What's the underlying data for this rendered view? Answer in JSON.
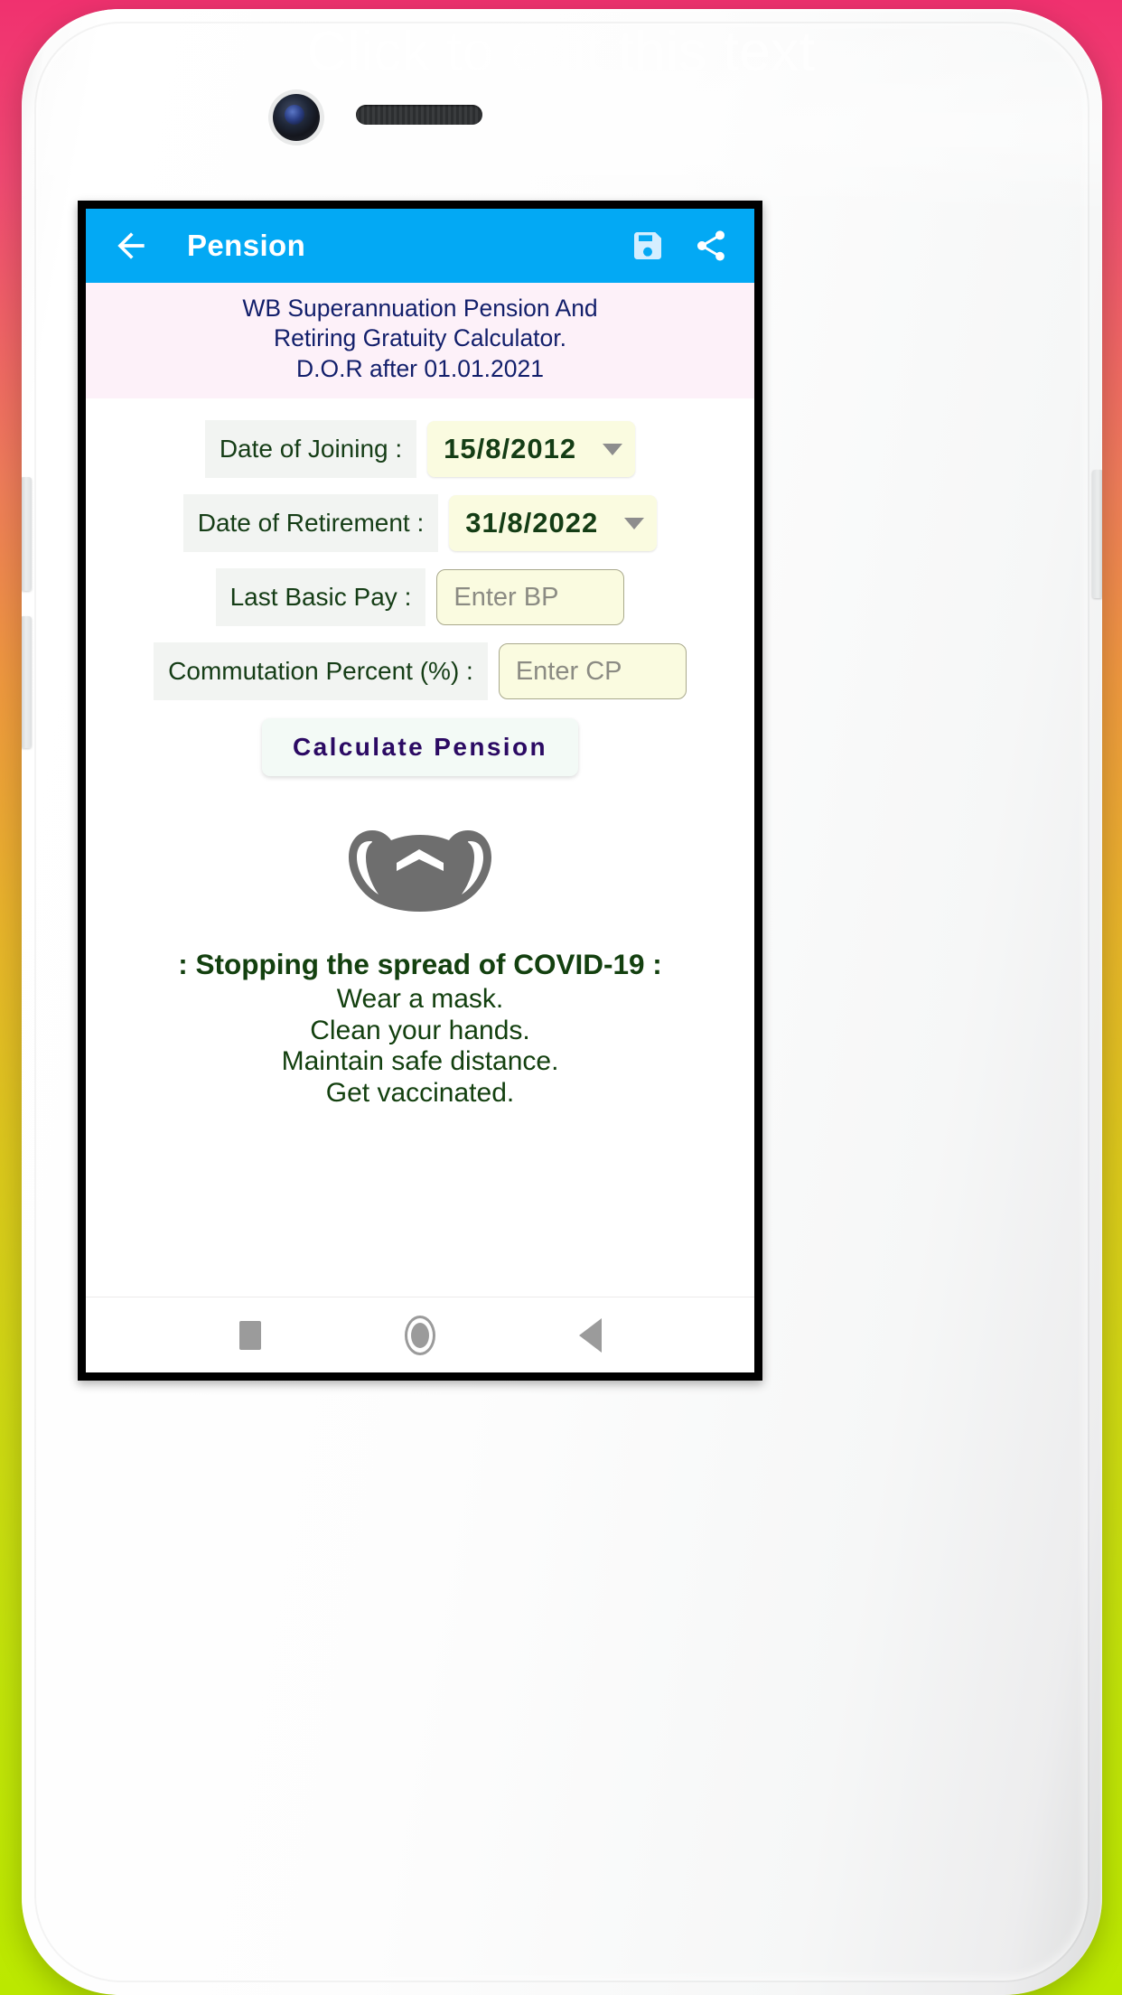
{
  "overlay": {
    "hint": "Click to edit this text"
  },
  "device": {
    "camera_icon": "camera-lens-icon",
    "speaker_icon": "earpiece-speaker-icon",
    "volume_up_button": "volume-up-button",
    "volume_down_button": "volume-down-button",
    "power_button": "power-button"
  },
  "appbar": {
    "back_icon": "back-arrow-icon",
    "title": "Pension",
    "save_icon": "save-floppy-icon",
    "share_icon": "share-icon",
    "background": "#03A9F4",
    "title_color": "#FFFFFF"
  },
  "banner": {
    "line1": "WB Superannuation Pension And",
    "line2": "Retiring Gratuity Calculator.",
    "line3": "D.O.R after 01.01.2021",
    "background": "#FDF1F9",
    "text_color": "#121F6B"
  },
  "form": {
    "rows": [
      {
        "label": "Date of Joining :",
        "type": "dropdown",
        "value": "15/8/2012",
        "caret_icon": "chevron-down-icon"
      },
      {
        "label": "Date of Retirement :",
        "type": "dropdown",
        "value": "31/8/2022",
        "caret_icon": "chevron-down-icon"
      },
      {
        "label": "Last Basic Pay :",
        "type": "input",
        "value": "",
        "placeholder": "Enter BP"
      },
      {
        "label": "Commutation Percent (%) :",
        "type": "input",
        "value": "",
        "placeholder": "Enter CP"
      }
    ],
    "label_background": "#F2F4F2",
    "label_color": "#153D16",
    "field_background": "#FAFBE0",
    "field_border": "#A9A98C"
  },
  "calculate": {
    "label": "Calculate Pension",
    "text_color": "#2B0A63",
    "background": "#F3FAF6"
  },
  "covid": {
    "mask_icon": "face-mask-icon",
    "mask_color": "#6E6E6E",
    "heading": ": Stopping the spread of COVID-19 :",
    "lines": [
      "Wear a mask.",
      "Clean your hands.",
      "Maintain safe distance.",
      "Get vaccinated."
    ],
    "text_color": "#13400F"
  },
  "navbar": {
    "recents_icon": "recents-square-icon",
    "home_icon": "home-circle-icon",
    "back_icon": "back-triangle-icon",
    "icon_color": "#9B9B9B"
  }
}
